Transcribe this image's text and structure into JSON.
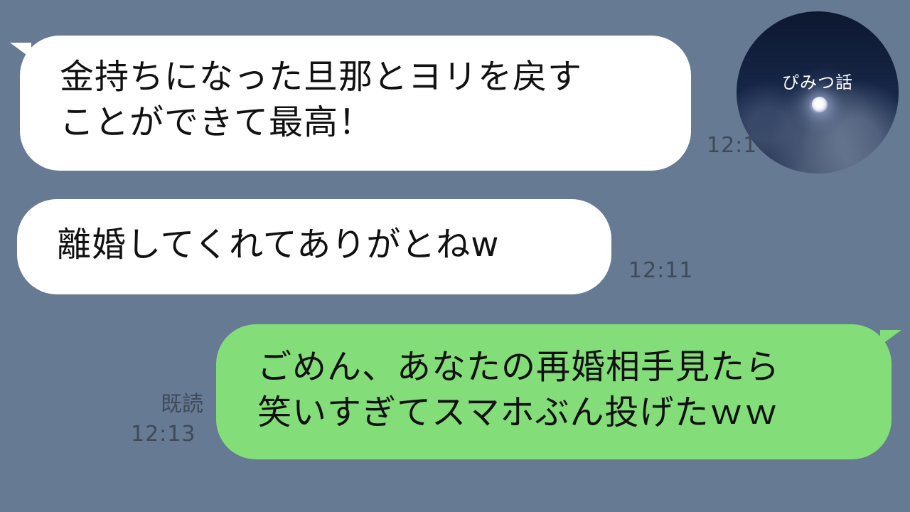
{
  "avatar": {
    "label": "ぴみつ話",
    "icon": "moon-night-sky-avatar"
  },
  "messages": [
    {
      "direction": "incoming",
      "lines": [
        "金持ちになった旦那とヨリを戻す",
        "ことができて最高！"
      ],
      "time": "12:1"
    },
    {
      "direction": "incoming",
      "lines": [
        "離婚してくれてありがとねw"
      ],
      "time": "12:11"
    },
    {
      "direction": "outgoing",
      "lines": [
        "ごめん、あなたの再婚相手見たら",
        "笑いすぎてスマホぶん投げたｗｗ"
      ],
      "read_status": "既読",
      "time": "12:13"
    }
  ],
  "colors": {
    "background": "#667a93",
    "incoming_bubble": "#ffffff",
    "outgoing_bubble": "#83dd78",
    "meta_text": "#3f4a59"
  }
}
